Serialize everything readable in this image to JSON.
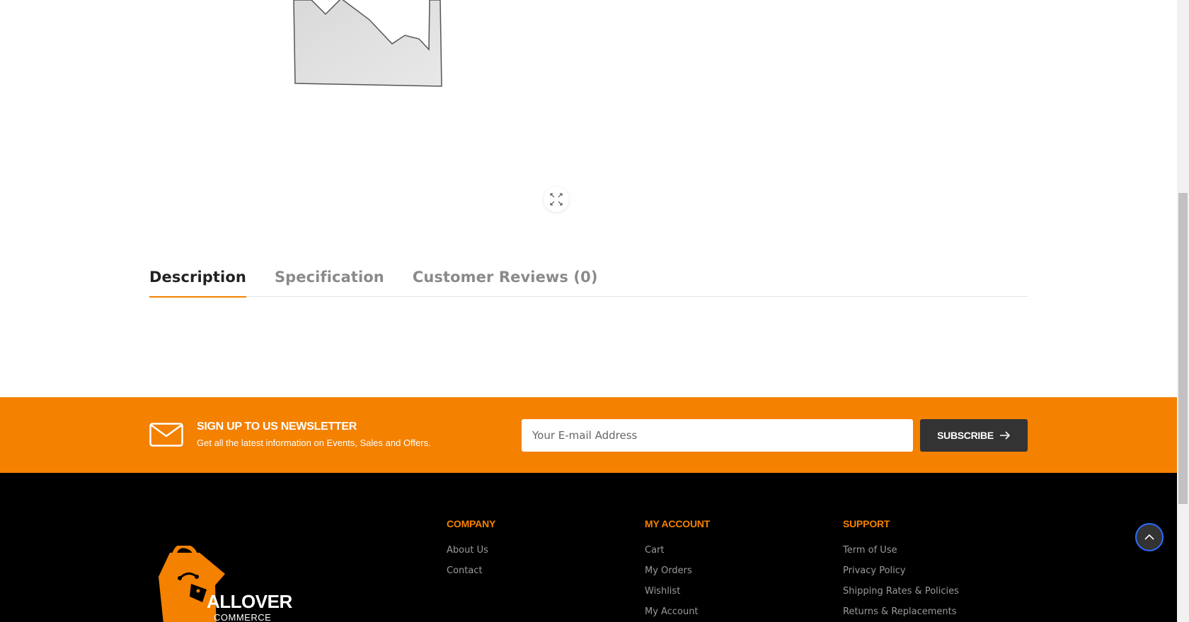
{
  "tabs": [
    {
      "label": "Description",
      "active": true
    },
    {
      "label": "Specification",
      "active": false
    },
    {
      "label": "Customer Reviews (0)",
      "active": false
    }
  ],
  "newsletter": {
    "title": "SIGN UP TO US NEWSLETTER",
    "subtitle": "Get all the latest information on Events, Sales and Offers.",
    "email_placeholder": "Your E-mail Address",
    "subscribe_label": "SUBSCRIBE"
  },
  "footer": {
    "logo_text": "ALLOVER",
    "logo_subtext": "COMMERCE",
    "company": {
      "title": "COMPANY",
      "links": [
        "About Us",
        "Contact"
      ]
    },
    "account": {
      "title": "MY ACCOUNT",
      "links": [
        "Cart",
        "My Orders",
        "Wishlist",
        "My Account"
      ]
    },
    "support": {
      "title": "SUPPORT",
      "links": [
        "Term of Use",
        "Privacy Policy",
        "Shipping Rates & Policies",
        "Returns & Replacements"
      ]
    }
  },
  "colors": {
    "accent": "#f48100",
    "dark": "#333333",
    "footer_bg": "#000000"
  }
}
